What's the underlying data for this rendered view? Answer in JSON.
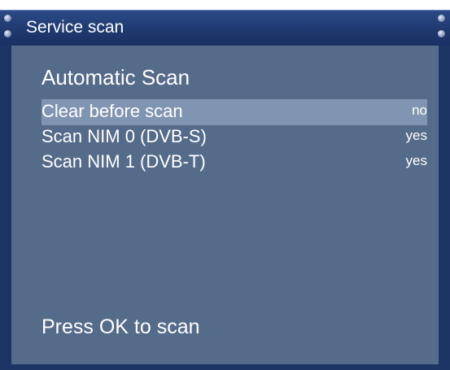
{
  "window": {
    "title": "Service scan"
  },
  "main": {
    "heading": "Automatic Scan",
    "options": [
      {
        "label": "Clear before scan",
        "value": "no"
      },
      {
        "label": "Scan NIM 0 (DVB-S)",
        "value": "yes"
      },
      {
        "label": "Scan NIM 1 (DVB-T)",
        "value": "yes"
      }
    ],
    "hint": "Press OK to scan"
  },
  "colors": {
    "titlebar": "#1f3a70",
    "content_bg": "#556b8a",
    "selected_row": "#8095b1",
    "text": "#ffffff"
  }
}
